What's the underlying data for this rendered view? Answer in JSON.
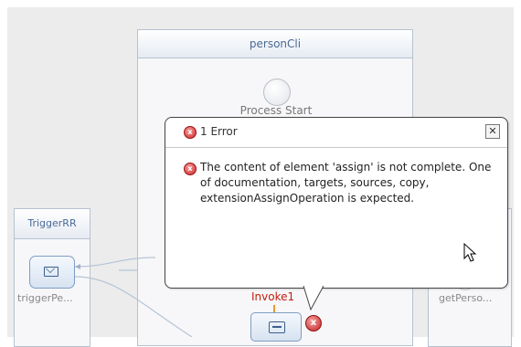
{
  "diagram": {
    "main_lane_title": "personCli",
    "left_lane_title": "TriggerRR",
    "start_label": "Process Start",
    "trigger_node_label": "triggerPe...",
    "get_person_label": "getPerso...",
    "invoke_label": "Invoke1",
    "error_marker_glyph": "x"
  },
  "error_popup": {
    "title": "1 Error",
    "close_glyph": "✕",
    "message": "The content of element 'assign' is not complete. One of documentation, targets, sources, copy, extensionAssignOperation is expected.",
    "icon": "error-icon"
  },
  "colors": {
    "lane_header_text": "#4a6a96",
    "error_red": "#d02424",
    "invoke_text": "#c02010"
  }
}
